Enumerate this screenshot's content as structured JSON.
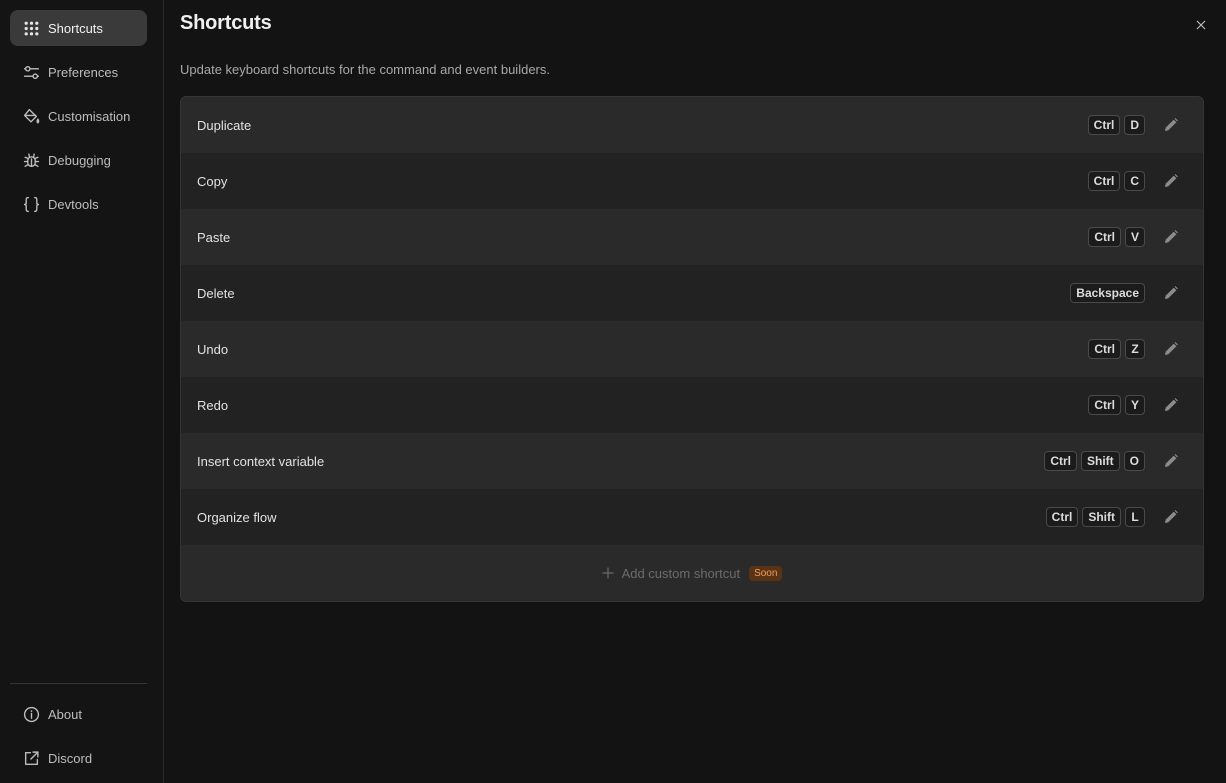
{
  "sidebar": {
    "items": [
      {
        "label": "Shortcuts",
        "icon": "grid-icon",
        "active": true
      },
      {
        "label": "Preferences",
        "icon": "sliders-icon"
      },
      {
        "label": "Customisation",
        "icon": "paint-bucket-icon"
      },
      {
        "label": "Debugging",
        "icon": "bug-icon"
      },
      {
        "label": "Devtools",
        "icon": "braces-icon"
      }
    ],
    "footer": [
      {
        "label": "About",
        "icon": "info-icon"
      },
      {
        "label": "Discord",
        "icon": "external-link-icon"
      }
    ]
  },
  "page": {
    "title": "Shortcuts",
    "subtitle": "Update keyboard shortcuts for the command and event builders."
  },
  "shortcuts": [
    {
      "label": "Duplicate",
      "keys": [
        "Ctrl",
        "D"
      ]
    },
    {
      "label": "Copy",
      "keys": [
        "Ctrl",
        "C"
      ]
    },
    {
      "label": "Paste",
      "keys": [
        "Ctrl",
        "V"
      ]
    },
    {
      "label": "Delete",
      "keys": [
        "Backspace"
      ]
    },
    {
      "label": "Undo",
      "keys": [
        "Ctrl",
        "Z"
      ]
    },
    {
      "label": "Redo",
      "keys": [
        "Ctrl",
        "Y"
      ]
    },
    {
      "label": "Insert context variable",
      "keys": [
        "Ctrl",
        "Shift",
        "O"
      ]
    },
    {
      "label": "Organize flow",
      "keys": [
        "Ctrl",
        "Shift",
        "L"
      ]
    }
  ],
  "add_shortcut": {
    "label": "Add custom shortcut",
    "badge": "Soon"
  },
  "colors": {
    "accent_badge_bg": "#5a3315",
    "accent_badge_text": "#f0a060"
  }
}
